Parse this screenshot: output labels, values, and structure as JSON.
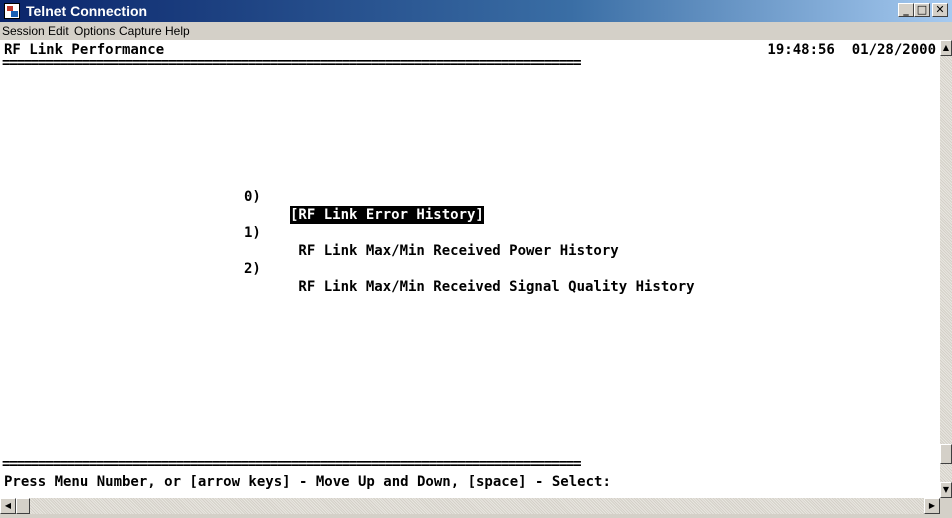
{
  "window": {
    "title": "Telnet Connection",
    "icon": "telnet-app-icon",
    "controls": {
      "minimize": "_",
      "maximize": "□",
      "close": "✕"
    }
  },
  "menubar": {
    "items": [
      "Session",
      "Edit",
      "Options",
      "Capture",
      "Help"
    ]
  },
  "terminal": {
    "header_title": "RF Link Performance",
    "clock": "19:48:56  01/28/2000",
    "rule": "================================================================================",
    "menu": [
      {
        "number": "0)",
        "label": "[RF Link Error History]",
        "selected": true
      },
      {
        "number": "1)",
        "label": " RF Link Max/Min Received Power History",
        "selected": false
      },
      {
        "number": "2)",
        "label": " RF Link Max/Min Received Signal Quality History",
        "selected": false
      }
    ],
    "prompt": "Press Menu Number, or [arrow keys] - Move Up and Down, [space] - Select:"
  },
  "scrollbars": {
    "up_glyph": "▲",
    "down_glyph": "▼",
    "left_glyph": "◀",
    "right_glyph": "▶"
  }
}
